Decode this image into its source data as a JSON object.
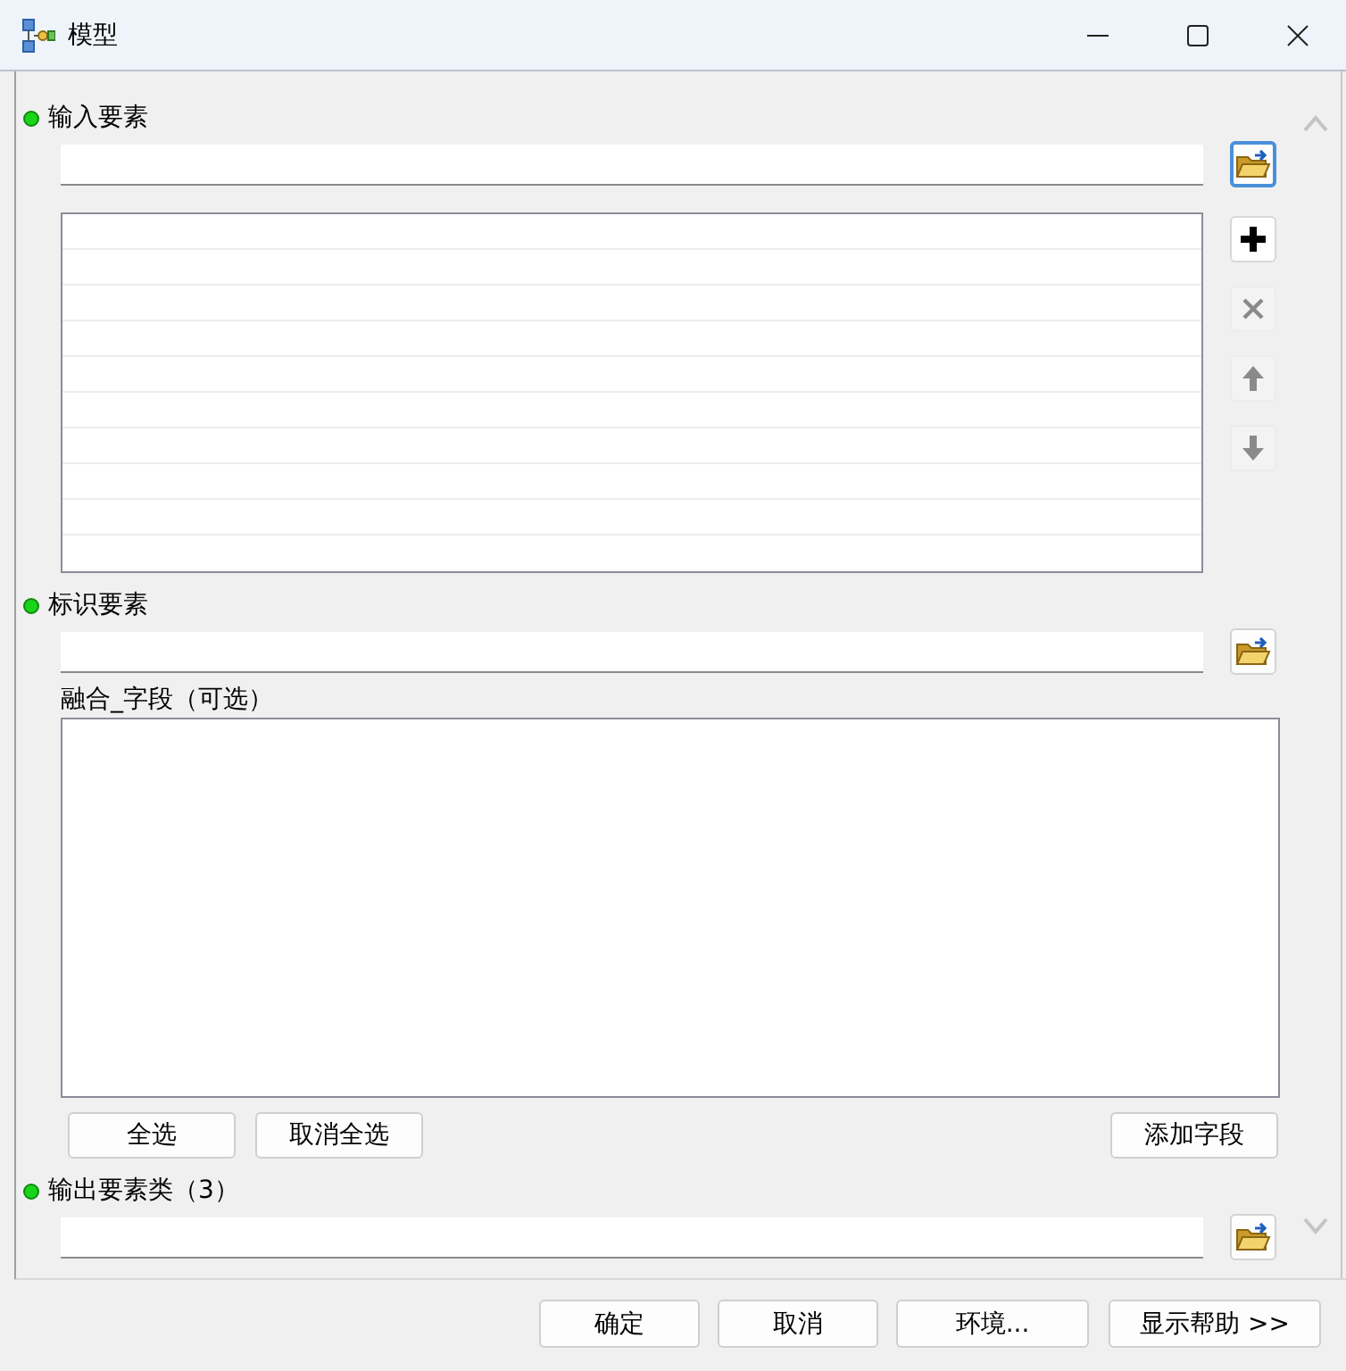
{
  "window": {
    "title": "模型"
  },
  "input_features": {
    "label": "输入要素",
    "required": true,
    "browse_focused": true
  },
  "list_tools": [
    {
      "kind": "add",
      "disabled": false
    },
    {
      "kind": "remove",
      "disabled": true
    },
    {
      "kind": "up",
      "disabled": true
    },
    {
      "kind": "down",
      "disabled": true
    }
  ],
  "identity_features": {
    "label": "标识要素",
    "required": true,
    "browse_focused": false
  },
  "dissolve_field": {
    "label": "融合_字段（可选）",
    "buttons": [
      {
        "label": "全选"
      },
      {
        "label": "取消全选"
      },
      {
        "label": "添加字段"
      }
    ]
  },
  "output": {
    "label": "输出要素类（3）",
    "required": true,
    "browse_focused": false
  },
  "footer_buttons": [
    {
      "label": "确定"
    },
    {
      "label": "取消"
    },
    {
      "label": "环境..."
    },
    {
      "label": "显示帮助 >>"
    }
  ]
}
